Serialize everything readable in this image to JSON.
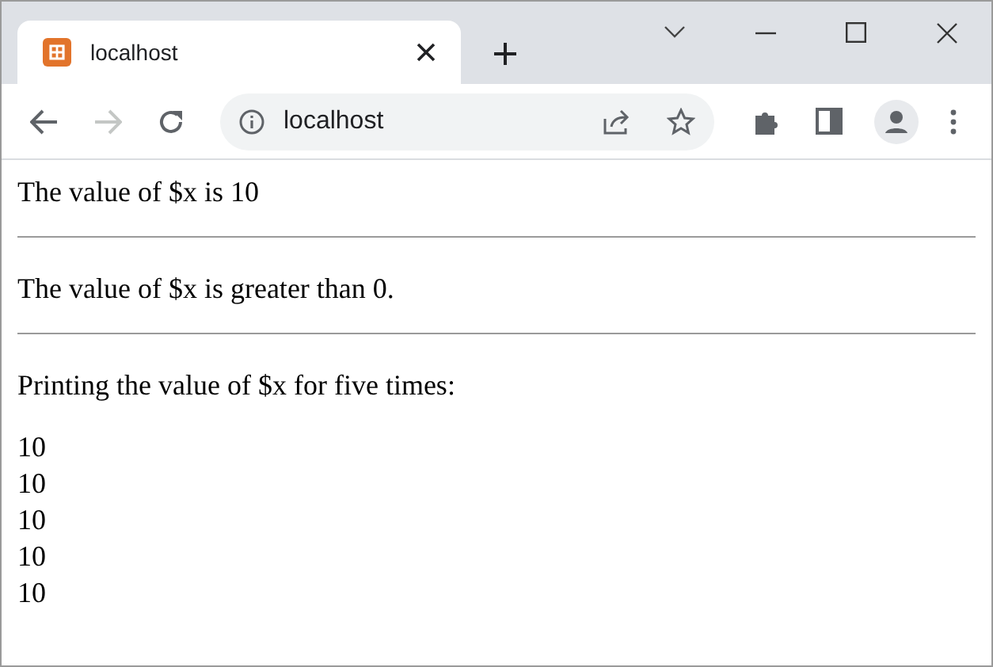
{
  "tab": {
    "title": "localhost",
    "selected": true
  },
  "toolbar": {
    "back_disabled": false,
    "forward_disabled": true,
    "address": "localhost"
  },
  "content": [
    {
      "kind": "text",
      "text": "The value of $x is 10"
    },
    {
      "kind": "rule"
    },
    {
      "kind": "text",
      "text": "The value of $x is greater than 0."
    },
    {
      "kind": "rule"
    },
    {
      "kind": "text",
      "text": "Printing the value of $x for five times:"
    },
    {
      "kind": "lines",
      "lines": [
        "10",
        "10",
        "10",
        "10",
        "10"
      ]
    }
  ]
}
